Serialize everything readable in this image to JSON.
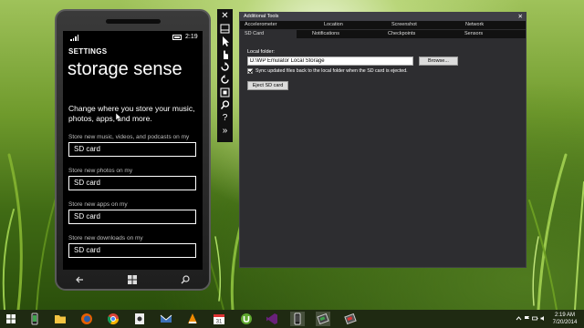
{
  "colors": {
    "phone_background": "#000000",
    "tools_background": "#2d2d30",
    "taskbar_background": "#1f2a12"
  },
  "phone": {
    "status_time": "2:19",
    "settings_label": "SETTINGS",
    "page_title": "storage sense",
    "description": "Change where you store your music, photos, apps, and more.",
    "options": [
      {
        "label": "Store new music, videos, and podcasts on my",
        "value": "SD card"
      },
      {
        "label": "Store new photos on my",
        "value": "SD card"
      },
      {
        "label": "Store new apps on my",
        "value": "SD card"
      },
      {
        "label": "Store new downloads on my",
        "value": "SD card"
      }
    ],
    "nav_icons": [
      "back-arrow-icon",
      "windows-start-icon",
      "search-icon"
    ]
  },
  "toolbar": {
    "icons": [
      "close-icon",
      "minimize-icon",
      "pointer-icon",
      "touch-icon",
      "rotate-left-icon",
      "rotate-right-icon",
      "fit-to-screen-icon",
      "zoom-icon",
      "help-icon",
      "more-tools-icon"
    ]
  },
  "tools": {
    "title": "Additional Tools",
    "close_glyph": "✕",
    "tabs_top": [
      "Accelerometer",
      "Location",
      "Screenshot",
      "Network"
    ],
    "tabs_bottom": [
      "SD Card",
      "Notifications",
      "Checkpoints",
      "Sensors"
    ],
    "active_tab": "SD Card",
    "sd_card": {
      "local_folder_label": "Local folder:",
      "local_folder_value": "D:\\WP Emulator Local Storage",
      "browse_label": "Browse...",
      "sync_checked": true,
      "sync_label": "Sync updated files back to the local folder when the SD card is ejected.",
      "eject_label": "Eject SD card"
    }
  },
  "taskbar": {
    "pinned_icons": [
      "phone-icon",
      "file-explorer-icon",
      "firefox-icon",
      "chrome-icon",
      "settings-app-icon",
      "mail-icon",
      "vlc-icon",
      "calendar-icon",
      "utorrent-icon",
      "visual-studio-icon",
      "emulator-icon",
      "tools-icon",
      "outlook-icon"
    ],
    "time": "2:19 AM",
    "date": "7/20/2014"
  }
}
